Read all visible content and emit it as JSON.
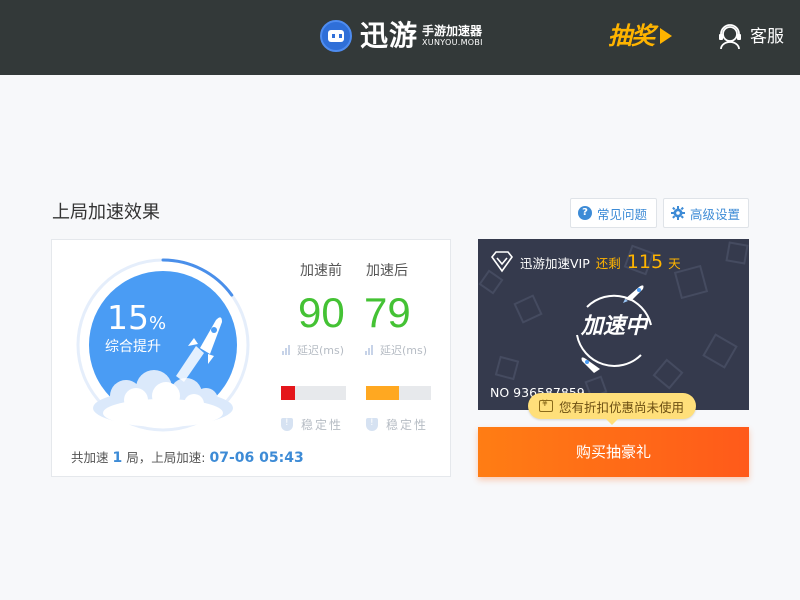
{
  "header": {
    "logo_name": "迅游",
    "logo_sub": "手游加速器",
    "logo_domain": "XUNYOU.MOBI",
    "lottery_label": "抽奖",
    "service_label": "客服"
  },
  "section": {
    "title": "上局加速效果",
    "faq_label": "常见问题",
    "advanced_label": "高级设置"
  },
  "result": {
    "percent": "15",
    "percent_sign": "%",
    "improve_label": "综合提升",
    "gauge_fraction": 0.15,
    "before_label": "加速前",
    "after_label": "加速后",
    "before_value": "90",
    "after_value": "79",
    "latency_label": "延迟(ms)",
    "stability_label": "稳定性",
    "before_stability": 0.22,
    "after_stability": 0.5,
    "before_bar_color": "#e4161b",
    "after_bar_color": "#ffa821",
    "count_prefix": "共加速",
    "count_value": "1",
    "count_suffix": "局，上局加速:",
    "last_time": "07-06 05:43"
  },
  "vip": {
    "title": "迅游加速VIP",
    "remain_label": "还剩",
    "days": "115",
    "days_unit": "天",
    "status": "加速中",
    "number": "NO 936587859",
    "coupon_text": "您有折扣优惠尚未使用",
    "buy_label": "购买抽豪礼"
  },
  "colors": {
    "header_bg": "#333939",
    "accent_blue": "#3d8bd6",
    "green": "#44c234",
    "orange": "#ff7d14",
    "gold": "#ffb400"
  }
}
